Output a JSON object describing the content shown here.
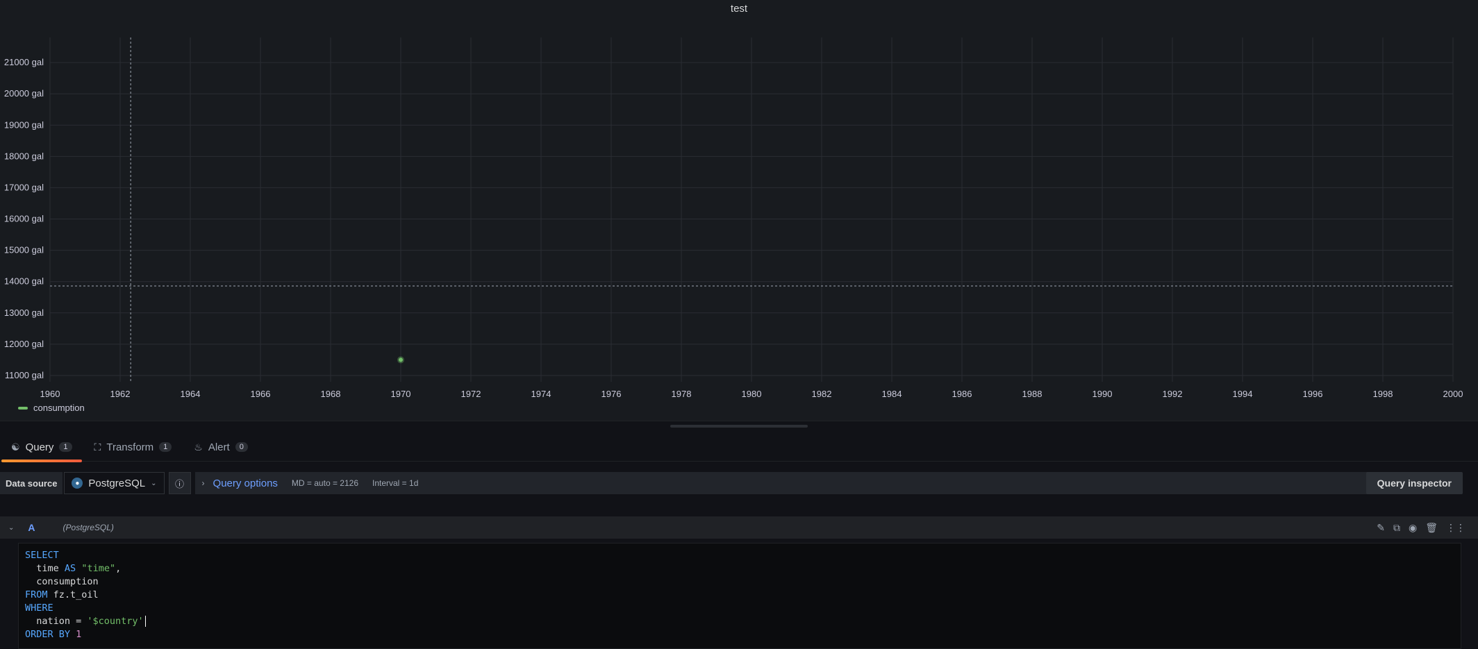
{
  "panel": {
    "title": "test"
  },
  "chart_data": {
    "type": "scatter",
    "title": "test",
    "xlim": [
      1960,
      2000
    ],
    "ylim": [
      10800,
      21800
    ],
    "x_ticks": [
      "1960",
      "1962",
      "1964",
      "1966",
      "1968",
      "1970",
      "1972",
      "1974",
      "1976",
      "1978",
      "1980",
      "1982",
      "1984",
      "1986",
      "1988",
      "1990",
      "1992",
      "1994",
      "1996",
      "1998",
      "2000"
    ],
    "y_ticks": [
      "21000 gal",
      "20000 gal",
      "19000 gal",
      "18000 gal",
      "17000 gal",
      "16000 gal",
      "15000 gal",
      "14000 gal",
      "13000 gal",
      "12000 gal",
      "11000 gal"
    ],
    "y_unit": "gal",
    "grid": true,
    "legend": "bottom-left",
    "series": [
      {
        "name": "consumption",
        "color": "#73bf69",
        "points": [
          {
            "x": 1970,
            "y": 11500
          }
        ]
      }
    ],
    "crosshair": {
      "x": 1962.3,
      "y": 13860
    }
  },
  "legend": {
    "items": [
      {
        "label": "consumption",
        "color": "#73bf69"
      }
    ]
  },
  "tabs": [
    {
      "label": "Query",
      "count": "1",
      "icon": "database-icon"
    },
    {
      "label": "Transform",
      "count": "1",
      "icon": "transform-icon"
    },
    {
      "label": "Alert",
      "count": "0",
      "icon": "bell-icon"
    }
  ],
  "toolbar": {
    "datasource_label": "Data source",
    "datasource_value": "PostgreSQL",
    "query_options_label": "Query options",
    "md_info": "MD = auto = 2126",
    "interval_info": "Interval = 1d",
    "query_inspector_label": "Query inspector"
  },
  "query": {
    "ref_id": "A",
    "datasource": "(PostgreSQL)",
    "sql": {
      "l1": "SELECT",
      "l2_a": "  time ",
      "l2_kw": "AS",
      "l2_str": "\"time\"",
      "l2_b": ",",
      "l3": "  consumption",
      "l4_kw": "FROM",
      "l4_b": " fz.t_oil",
      "l5": "WHERE",
      "l6_a": "  nation = ",
      "l6_str": "'$country'",
      "l7_kw": "ORDER BY",
      "l7_num": "1"
    }
  },
  "colors": {
    "accent": "#6e9fff",
    "series": "#73bf69",
    "tab_underline_from": "#ff9830",
    "tab_underline_to": "#ef5a3c"
  }
}
